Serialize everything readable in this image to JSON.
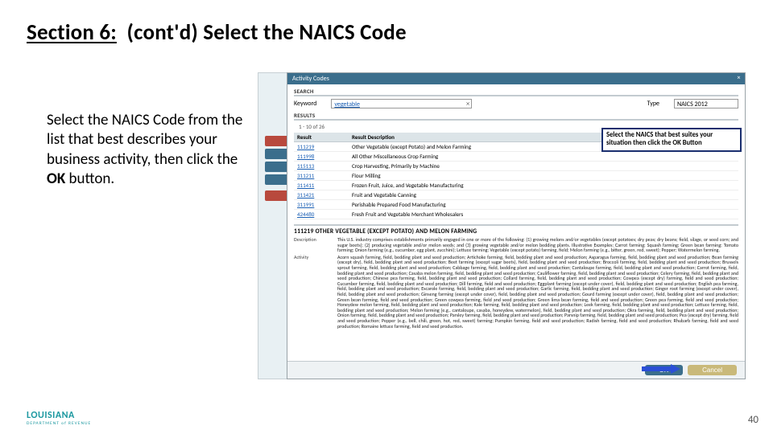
{
  "title": {
    "section": "Section 6:",
    "rest": "(cont'd) Select the NAICS Code"
  },
  "body": {
    "pre": "Select the NAICS Code from the list that best describes your business activity, then click the ",
    "bold": "OK",
    "post": " button."
  },
  "modal": {
    "title": "Activity Codes",
    "search": {
      "hdr": "SEARCH",
      "kw_label": "Keyword",
      "kw_value": "vegetable",
      "type_label": "Type",
      "type_value": "NAICS 2012"
    },
    "results": {
      "hdr": "RESULTS",
      "pager": "1 - 10 of 26",
      "cols": [
        "Result",
        "Result Description"
      ],
      "rows": [
        [
          "111219",
          "Other Vegetable (except Potato) and Melon Farming"
        ],
        [
          "111998",
          "All Other Miscellaneous Crop Farming"
        ],
        [
          "115113",
          "Crop Harvesting, Primarily by Machine"
        ],
        [
          "311211",
          "Flour Milling"
        ],
        [
          "311411",
          "Frozen Fruit, Juice, and Vegetable Manufacturing"
        ],
        [
          "311421",
          "Fruit and Vegetable Canning"
        ],
        [
          "311991",
          "Perishable Prepared Food Manufacturing"
        ],
        [
          "424480",
          "Fresh Fruit and Vegetable Merchant Wholesalers"
        ]
      ]
    },
    "callout": "Select the NAICS that best suites your situation then click the OK Button",
    "detail": {
      "title": "111219 OTHER VEGETABLE (EXCEPT POTATO) AND MELON FARMING",
      "desc_lbl": "Description",
      "desc": "This U.S. industry comprises establishments primarily engaged in one or more of the following: (1) growing melons and/or vegetables (except potatoes; dry peas; dry beans; field, silage, or seed corn; and sugar beets); (2) producing vegetable and/or melon seeds; and (3) growing vegetable and/or melon bedding plants. Illustrative Examples: Carrot farming; Squash farming; Green bean farming; Tomato farming; Onion farming (e.g., cucumber, egg plant, zucchini); Lettuce farming; Vegetable (except potato) farming, field; Melon farming (e.g., bitter, green, red, sweet); Pepper; Watermelon farming.",
      "act_lbl": "Activity",
      "act": "Acorn squash farming, field, bedding plant and seed production; Artichoke farming, field, bedding plant and seed production; Asparagus farming, field, bedding plant and seed production; Bean farming (except dry), field, bedding plant and seed production; Beet farming (except sugar beets), field, bedding plant and seed production; Broccoli farming, field, bedding plant and seed production; Brussels sprout farming, field, bedding plant and seed production; Cabbage farming, field, bedding plant and seed production; Cantaloupe farming, field, bedding plant and seed production; Carrot farming, field, bedding plant and seed production; Casaba melon farming, field, bedding plant and seed production; Cauliflower farming, field, bedding plant and seed production; Celery farming, field, bedding plant and seed production; Chinese pea farming, field, bedding plant and seed production; Collard farming, field, bedding plant and seed production; Cowpea (except dry) farming, field and seed production; Cucumber farming, field, bedding plant and seed production; Dill farming, field and seed production; Eggplant farming (except under cover), field, bedding plant and seed production; English pea farming, field, bedding plant and seed production; Escarole farming, field, bedding plant and seed production; Garlic farming, field, bedding plant and seed production; Ginger root farming (except under cover), field, bedding plant and seed production; Ginseng farming (except under cover), field, bedding plant and seed production; Gourd farming (except under cover), field, bedding plant and seed production; Green bean farming, field and seed production; Green cowpea farming, field and seed production; Green lima bean farming, field and seed production; Green pea farming, field and seed production; Honeydew melon farming, field, bedding plant and seed production; Kale farming, field, bedding plant and seed production; Leek farming, field, bedding plant and seed production; Lettuce farming, field, bedding plant and seed production; Melon farming (e.g., cantaloupe, casaba, honeydew, watermelon), field, bedding plant and seed production; Okra farming, field, bedding plant and seed production; Onion farming, field, bedding plant and seed production; Parsley farming, field, bedding plant and seed production; Parsnip farming, field, bedding plant and seed production; Pea (except dry) farming, field and seed production; Pepper (e.g., bell, chili, green, hot, red, sweet) farming; Pumpkin farming, field and seed production; Radish farming, field and seed production; Rhubarb farming, field and seed production; Romaine lettuce farming, field and seed production."
    },
    "buttons": {
      "ok": "OK",
      "cancel": "Cancel"
    }
  },
  "page_number": "40",
  "logo": {
    "main": "LOUISIANA",
    "sub": "DEPARTMENT of REVENUE"
  }
}
